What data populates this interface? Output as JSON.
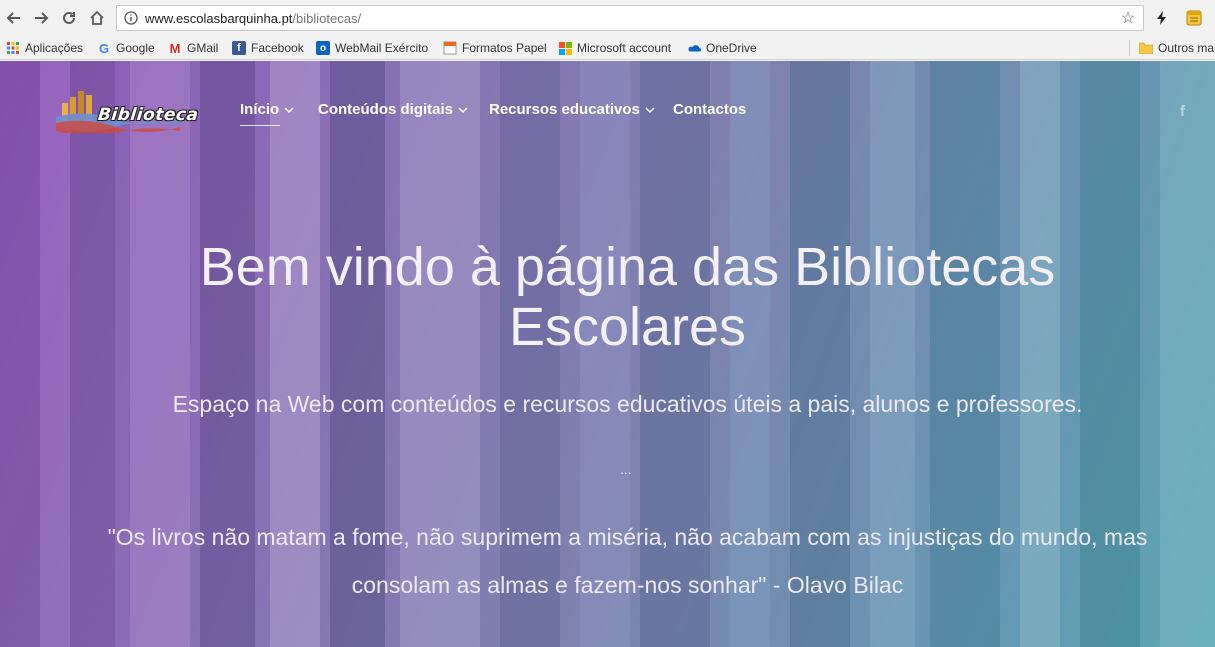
{
  "browser": {
    "url_host": "www.escolasbarquinha.pt",
    "url_path": "/bibliotecas/",
    "icons": {
      "back": "back-arrow-icon",
      "forward": "forward-arrow-icon",
      "reload": "reload-icon",
      "home": "home-icon",
      "info": "info-icon",
      "bookmark_star": "star-icon"
    },
    "bookmarks": [
      {
        "label": "Aplicações",
        "icon": "apps-grid-icon"
      },
      {
        "label": "Google",
        "icon": "google-icon"
      },
      {
        "label": "GMail",
        "icon": "gmail-icon"
      },
      {
        "label": "Facebook",
        "icon": "facebook-icon"
      },
      {
        "label": "WebMail Exército",
        "icon": "outlook-icon"
      },
      {
        "label": "Formatos Papel",
        "icon": "page-icon"
      },
      {
        "label": "Microsoft account",
        "icon": "microsoft-icon"
      },
      {
        "label": "OneDrive",
        "icon": "onedrive-icon"
      }
    ],
    "other_bookmarks": "Outros ma"
  },
  "site": {
    "logo_text": "Biblioteca",
    "nav": [
      {
        "label": "Início",
        "has_dropdown": true,
        "active": true
      },
      {
        "label": "Conteúdos digitais",
        "has_dropdown": true
      },
      {
        "label": "Recursos educativos",
        "has_dropdown": true
      },
      {
        "label": "Contactos",
        "has_dropdown": false
      }
    ],
    "social": "f",
    "hero": {
      "title_line1": "Bem vindo à página das Bibliotecas",
      "title_line2": "Escolares",
      "subtitle": "Espaço na Web com conteúdos e recursos educativos úteis a pais, alunos e professores.",
      "separator": "...",
      "quote_line1": "\"Os livros não matam a fome, não suprimem a miséria, não acabam com as injustiças do mundo, mas",
      "quote_line2": "consolam as almas e fazem-nos sonhar\" - Olavo Bilac"
    }
  },
  "colors": {
    "gradient_left": "#8d5ab8",
    "gradient_right": "#5aa6b2",
    "text": "#f4f0fa"
  }
}
